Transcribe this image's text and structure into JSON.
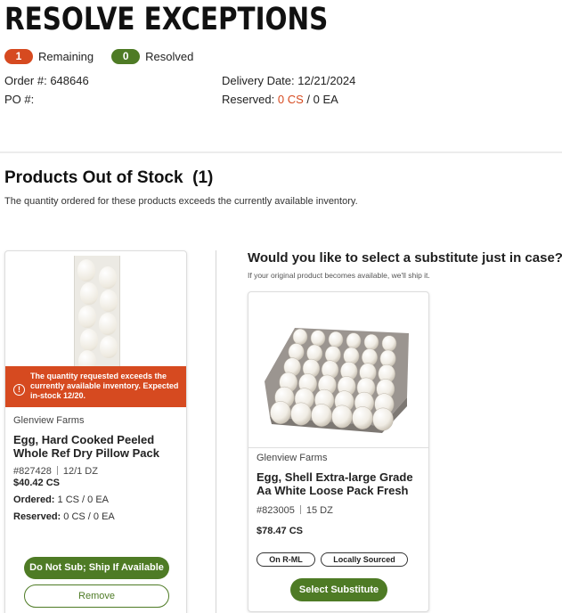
{
  "page": {
    "title": "RESOLVE EXCEPTIONS"
  },
  "counts": {
    "remaining_count": "1",
    "remaining_label": "Remaining",
    "resolved_count": "0",
    "resolved_label": "Resolved"
  },
  "order": {
    "order_label": "Order #:",
    "order_number": "648646",
    "po_label": "PO #:",
    "po_number": "",
    "delivery_label": "Delivery Date:",
    "delivery_date": "12/21/2024",
    "reserved_label": "Reserved:",
    "reserved_cs": "0 CS",
    "reserved_sep": " / ",
    "reserved_ea": "0 EA"
  },
  "section": {
    "title": "Products Out of Stock  (1)",
    "description": "The quantity ordered for these products exceeds the currently available inventory."
  },
  "out_of_stock_item": {
    "warning": "The quantity requested exceeds the currently available inventory. Expected in-stock 12/20.",
    "vendor": "Glenview Farms",
    "name": "Egg, Hard Cooked Peeled Whole Ref Dry Pillow Pack",
    "sku": "#827428",
    "pack": "12/1 DZ",
    "price": "$40.42 CS",
    "ordered_label": "Ordered:",
    "ordered_value": "1 CS / 0 EA",
    "reserved_label": "Reserved:",
    "reserved_value": "0 CS / 0 EA",
    "primary_button": "Do Not Sub; Ship If Available",
    "secondary_button": "Remove"
  },
  "substitute": {
    "heading": "Would you like to select a substitute just in case?",
    "description": "If your original product becomes available, we'll ship it.",
    "item": {
      "vendor": "Glenview Farms",
      "name": "Egg, Shell Extra-large Grade Aa White Loose Pack Fresh",
      "sku": "#823005",
      "pack": "15 DZ",
      "price": "$78.47 CS",
      "tags": [
        "On R-ML",
        "Locally Sourced"
      ],
      "button": "Select Substitute"
    }
  },
  "colors": {
    "alert": "#d64a20",
    "primary": "#4e7b25"
  }
}
